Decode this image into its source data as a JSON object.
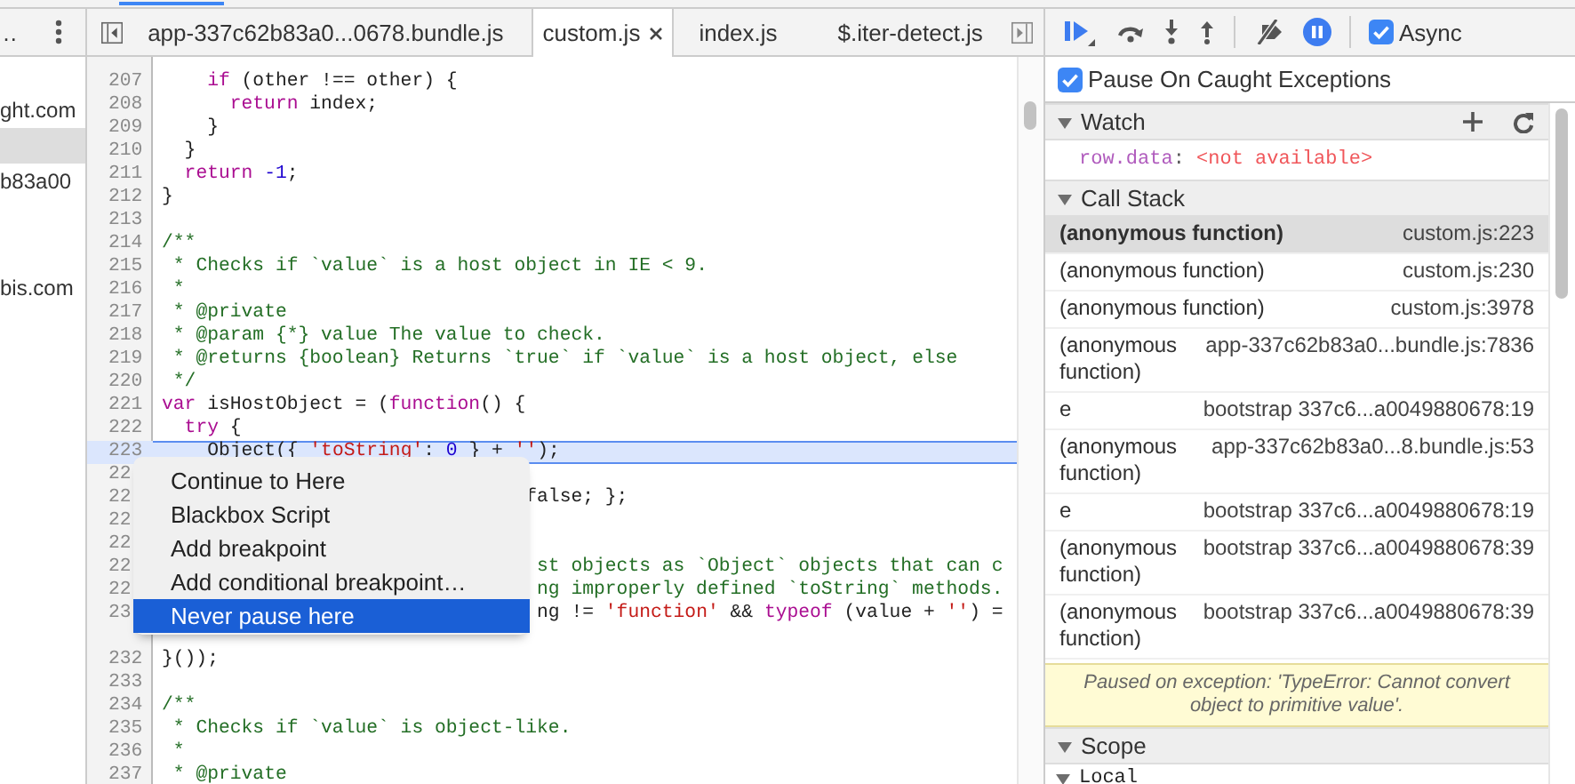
{
  "sidebar": {
    "header_text": "…",
    "items": [
      {
        "selected": false
      },
      {
        "label": "ght.com",
        "selected": false
      },
      {
        "selected": true
      },
      {
        "label": "b83a00",
        "selected": false
      },
      {
        "selected": false
      },
      {
        "selected": false
      },
      {
        "label": "bis.com",
        "selected": false
      }
    ]
  },
  "editor": {
    "tabs": [
      {
        "label": "app-337c62b83a0...0678.bundle.js",
        "selected": false,
        "closable": false
      },
      {
        "label": "custom.js",
        "selected": true,
        "closable": true
      },
      {
        "label": "index.js",
        "selected": false,
        "closable": false
      },
      {
        "label": "$.iter-detect.js",
        "selected": false,
        "closable": false
      }
    ],
    "lines": [
      {
        "number": "207",
        "highlighted": false,
        "segments": [
          {
            "kind": "kw",
            "text": "    if"
          },
          {
            "kind": "plain",
            "text": " (other !== other) {"
          }
        ]
      },
      {
        "number": "208",
        "highlighted": false,
        "segments": [
          {
            "kind": "kw",
            "text": "      return"
          },
          {
            "kind": "plain",
            "text": " index;"
          }
        ]
      },
      {
        "number": "209",
        "highlighted": false,
        "segments": [
          {
            "kind": "plain",
            "text": "    }"
          }
        ]
      },
      {
        "number": "210",
        "highlighted": false,
        "segments": [
          {
            "kind": "plain",
            "text": "  }"
          }
        ]
      },
      {
        "number": "211",
        "highlighted": false,
        "segments": [
          {
            "kind": "kw",
            "text": "  return"
          },
          {
            "kind": "num",
            "text": " -1"
          },
          {
            "kind": "plain",
            "text": ";"
          }
        ]
      },
      {
        "number": "212",
        "highlighted": false,
        "segments": [
          {
            "kind": "plain",
            "text": "}"
          }
        ]
      },
      {
        "number": "213",
        "highlighted": false
      },
      {
        "number": "214",
        "highlighted": false,
        "segments": [
          {
            "kind": "cm",
            "text": "/**"
          }
        ]
      },
      {
        "number": "215",
        "highlighted": false,
        "segments": [
          {
            "kind": "cm",
            "text": " * Checks if `value` is a host object in IE < 9."
          }
        ]
      },
      {
        "number": "216",
        "highlighted": false,
        "segments": [
          {
            "kind": "cm",
            "text": " *"
          }
        ]
      },
      {
        "number": "217",
        "highlighted": false,
        "segments": [
          {
            "kind": "cm",
            "text": " * @private"
          }
        ]
      },
      {
        "number": "218",
        "highlighted": false,
        "segments": [
          {
            "kind": "cm",
            "text": " * @param {*} value The value to check."
          }
        ]
      },
      {
        "number": "219",
        "highlighted": false,
        "segments": [
          {
            "kind": "cm",
            "text": " * @returns {boolean} Returns `true` if `value` is a host object, else"
          }
        ]
      },
      {
        "number": "220",
        "highlighted": false,
        "segments": [
          {
            "kind": "cm",
            "text": " */"
          }
        ]
      },
      {
        "number": "221",
        "highlighted": false,
        "segments": [
          {
            "kind": "kw",
            "text": "var"
          },
          {
            "kind": "plain",
            "text": " isHostObject = ("
          },
          {
            "kind": "kw",
            "text": "function"
          },
          {
            "kind": "plain",
            "text": "() {"
          }
        ]
      },
      {
        "number": "222",
        "highlighted": false,
        "segments": [
          {
            "kind": "kw",
            "text": "  try"
          },
          {
            "kind": "plain",
            "text": " {"
          }
        ]
      },
      {
        "number": "223",
        "highlighted": true,
        "segments": [
          {
            "kind": "plain",
            "text": "    Object({ "
          },
          {
            "kind": "str",
            "text": "'toString'"
          },
          {
            "kind": "plain",
            "text": ": "
          },
          {
            "kind": "num",
            "text": "0"
          },
          {
            "kind": "plain",
            "text": " } + "
          },
          {
            "kind": "str",
            "text": "''"
          },
          {
            "kind": "plain",
            "text": ");"
          }
        ]
      },
      {
        "number": "22",
        "highlighted": false
      },
      {
        "number": "22",
        "highlighted": false,
        "segments": [
          {
            "kind": "plain",
            "text": "                                false; };"
          }
        ]
      },
      {
        "number": "22",
        "highlighted": false
      },
      {
        "number": "22",
        "highlighted": false
      },
      {
        "number": "22",
        "highlighted": false,
        "segments": [
          {
            "kind": "cm",
            "text": "                                 st objects as `Object` objects that can c"
          }
        ]
      },
      {
        "number": "22",
        "highlighted": false,
        "segments": [
          {
            "kind": "cm",
            "text": "                                 ng improperly defined `toString` methods."
          }
        ]
      },
      {
        "number": "23",
        "highlighted": false,
        "segments": [
          {
            "kind": "plain",
            "text": "                                 ng != "
          },
          {
            "kind": "str",
            "text": "'function'"
          },
          {
            "kind": "plain",
            "text": " && "
          },
          {
            "kind": "kw",
            "text": "typeof"
          },
          {
            "kind": "plain",
            "text": " (value + "
          },
          {
            "kind": "str",
            "text": "''"
          },
          {
            "kind": "plain",
            "text": ") ="
          }
        ]
      },
      {
        "highlighted": false
      },
      {
        "number": "232",
        "highlighted": false,
        "segments": [
          {
            "kind": "plain",
            "text": "}());"
          }
        ]
      },
      {
        "number": "233",
        "highlighted": false
      },
      {
        "number": "234",
        "highlighted": false,
        "segments": [
          {
            "kind": "cm",
            "text": "/**"
          }
        ]
      },
      {
        "number": "235",
        "highlighted": false,
        "segments": [
          {
            "kind": "cm",
            "text": " * Checks if `value` is object-like."
          }
        ]
      },
      {
        "number": "236",
        "highlighted": false,
        "segments": [
          {
            "kind": "cm",
            "text": " *"
          }
        ]
      },
      {
        "number": "237",
        "highlighted": false,
        "segments": [
          {
            "kind": "cm",
            "text": " * @private"
          }
        ]
      }
    ]
  },
  "context_menu": {
    "items": [
      {
        "label": "Continue to Here",
        "selected": false
      },
      {
        "label": "Blackbox Script",
        "selected": false
      },
      {
        "label": "Add breakpoint",
        "selected": false
      },
      {
        "label": "Add conditional breakpoint…",
        "selected": false
      },
      {
        "label": "Never pause here",
        "selected": true
      }
    ]
  },
  "debugger": {
    "pause_on_exceptions": true,
    "async": {
      "label": "Async",
      "checked": true
    },
    "pause_on_caught": {
      "label": "Pause On Caught Exceptions",
      "checked": true
    },
    "watch": {
      "title": "Watch",
      "expanded": true,
      "expressions": [
        {
          "name": "row.data",
          "separator": ":",
          "value": "<not available>"
        }
      ]
    },
    "call_stack": {
      "title": "Call Stack",
      "expanded": true,
      "frames": [
        {
          "name": "(anonymous function)",
          "location": "custom.js:223",
          "selected": true
        },
        {
          "name": "(anonymous function)",
          "location": "custom.js:230",
          "selected": false
        },
        {
          "name": "(anonymous function)",
          "location": "custom.js:3978",
          "selected": false
        },
        {
          "name": "(anonymous function)",
          "location": "app-337c62b83a0...bundle.js:7836",
          "selected": false
        },
        {
          "name": "e",
          "location": "bootstrap 337c6...a0049880678:19",
          "selected": false
        },
        {
          "name": "(anonymous function)",
          "location": "app-337c62b83a0...8.bundle.js:53",
          "selected": false
        },
        {
          "name": "e",
          "location": "bootstrap 337c6...a0049880678:19",
          "selected": false
        },
        {
          "name": "(anonymous function)",
          "location": "bootstrap 337c6...a0049880678:39",
          "selected": false
        },
        {
          "name": "(anonymous function)",
          "location": "bootstrap 337c6...a0049880678:39",
          "selected": false
        }
      ]
    },
    "paused_message": "Paused on exception: 'TypeError: Cannot convert object to primitive value'.",
    "scope": {
      "title": "Scope",
      "expanded": true,
      "groups": [
        {
          "label": "Local",
          "expanded": true
        }
      ]
    }
  }
}
